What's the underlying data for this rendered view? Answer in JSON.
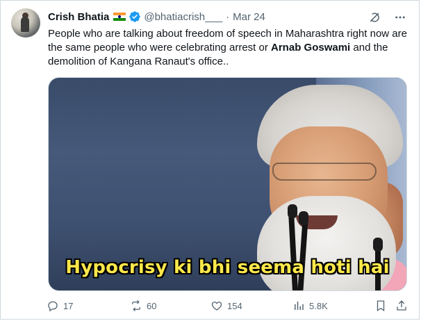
{
  "tweet": {
    "author_name": "Crish Bhatia",
    "author_handle": "@bhatiacrish___",
    "separator": "·",
    "timestamp": "Mar 24",
    "text_before": "People who are talking about freedom of speech in Maharashtra right now are the same people who were celebrating arrest or ",
    "text_bold": "Arnab Goswami",
    "text_after": " and the demolition of Kangana Ranaut's office..",
    "media_caption": "Hypocrisy ki bhi seema hoti hai"
  },
  "actions": {
    "replies": "17",
    "retweets": "60",
    "likes": "154",
    "views": "5.8K"
  },
  "icons": {
    "verified": "verified-badge-icon",
    "grok": "grok-icon",
    "more": "more-icon",
    "reply": "reply-icon",
    "retweet": "retweet-icon",
    "like": "like-icon",
    "views": "views-icon",
    "bookmark": "bookmark-icon",
    "share": "share-icon"
  },
  "colors": {
    "text": "#0f1419",
    "muted": "#536471",
    "verified": "#1d9bf0",
    "caption": "#ffe84a"
  }
}
